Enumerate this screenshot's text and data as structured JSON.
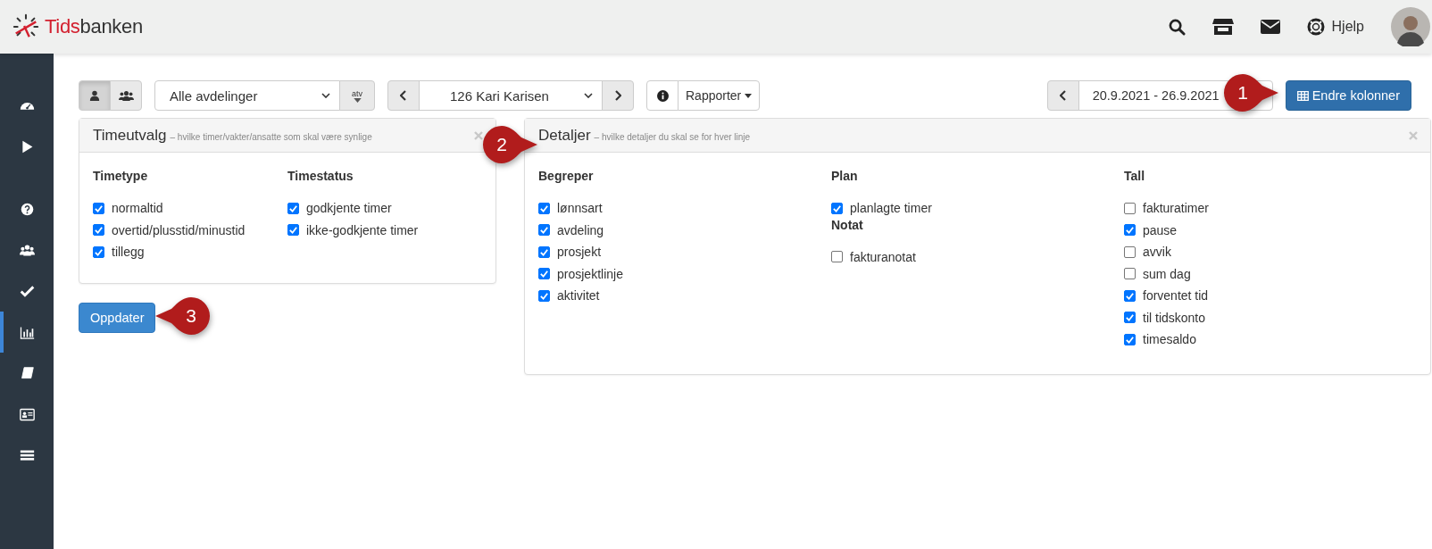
{
  "header": {
    "brand_first": "Tids",
    "brand_second": "banken",
    "help_label": "Hjelp"
  },
  "sidebar": {
    "items": [
      {
        "selected": false
      },
      {
        "selected": false
      },
      {
        "selected": false
      },
      {
        "selected": false
      },
      {
        "selected": false
      },
      {
        "selected": true
      },
      {
        "selected": false
      },
      {
        "selected": false
      },
      {
        "selected": false
      }
    ]
  },
  "toolbar": {
    "view_toggle": [
      {
        "selected": true
      },
      {
        "selected": false
      }
    ],
    "department_select": "Alle avdelinger",
    "atv_label": "atv",
    "employee_select": "126 Kari Karisen",
    "reports_button": "Rapporter",
    "date_range": "20.9.2021 - 26.9.2021",
    "columns_button": "Endre kolonner"
  },
  "panels": [
    {
      "title": "Timeutvalg",
      "subtitle": "– hvilke timer/vakter/ansatte som skal være synlige",
      "columns": [
        [
          {
            "heading": "Timetype",
            "items": [
              {
                "label": "normaltid",
                "checked": true
              },
              {
                "label": "overtid/plusstid/minustid",
                "checked": true
              },
              {
                "label": "tillegg",
                "checked": true
              }
            ]
          }
        ],
        [
          {
            "heading": "Timestatus",
            "items": [
              {
                "label": "godkjente timer",
                "checked": true
              },
              {
                "label": "ikke-godkjente timer",
                "checked": true
              }
            ]
          }
        ]
      ]
    },
    {
      "title": "Detaljer",
      "subtitle": "– hvilke detaljer du skal se for hver linje",
      "columns": [
        [
          {
            "heading": "Begreper",
            "items": [
              {
                "label": "lønnsart",
                "checked": true
              },
              {
                "label": "avdeling",
                "checked": true
              },
              {
                "label": "prosjekt",
                "checked": true
              },
              {
                "label": "prosjektlinje",
                "checked": true
              },
              {
                "label": "aktivitet",
                "checked": true
              }
            ]
          }
        ],
        [
          {
            "heading": "Plan",
            "items": [
              {
                "label": "planlagte timer",
                "checked": true
              }
            ]
          },
          {
            "heading": "Notat",
            "items": [
              {
                "label": "fakturanotat",
                "checked": false
              }
            ]
          }
        ],
        [
          {
            "heading": "Tall",
            "items": [
              {
                "label": "fakturatimer",
                "checked": false
              },
              {
                "label": "pause",
                "checked": true
              },
              {
                "label": "avvik",
                "checked": false
              },
              {
                "label": "sum dag",
                "checked": false
              },
              {
                "label": "forventet tid",
                "checked": true
              },
              {
                "label": "til tidskonto",
                "checked": true
              },
              {
                "label": "timesaldo",
                "checked": true
              }
            ]
          }
        ]
      ]
    }
  ],
  "update_button": "Oppdater",
  "callouts": [
    {
      "label": "1"
    },
    {
      "label": "2"
    },
    {
      "label": "3"
    }
  ]
}
